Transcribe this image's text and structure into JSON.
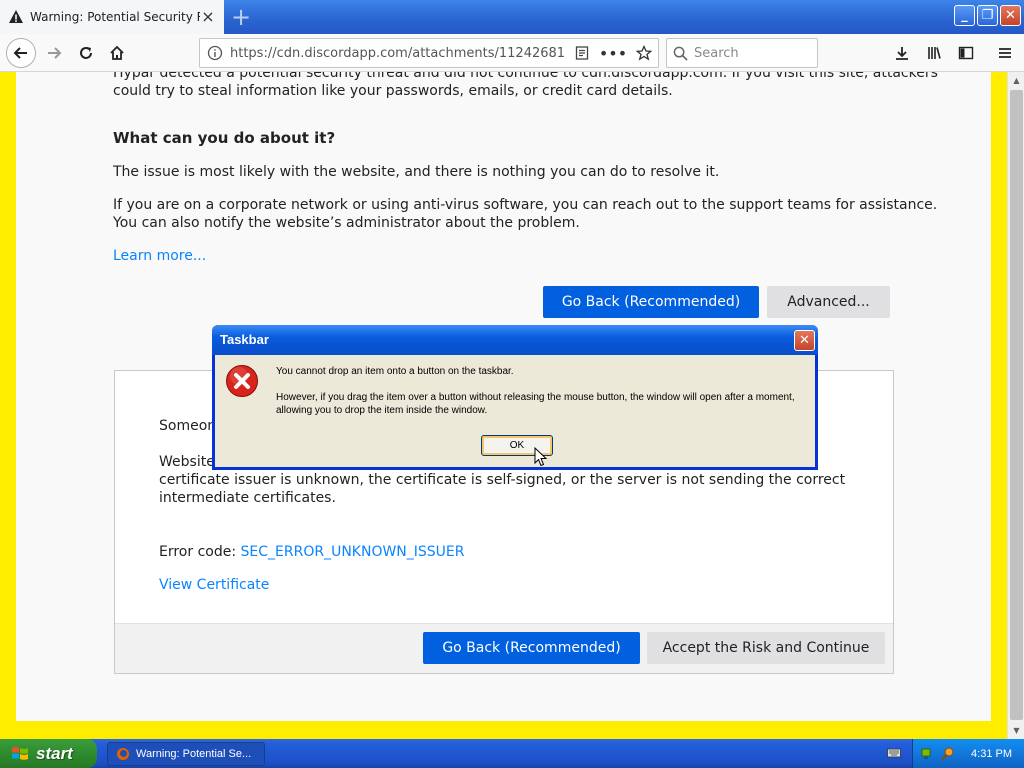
{
  "browser": {
    "tab_title": "Warning: Potential Security Risk A",
    "url": "https://cdn.discordapp.com/attachments/11242681",
    "search_placeholder": "Search"
  },
  "page": {
    "partial_top_line": "Hypar detected a potential security threat and did not continue to cdn.discordapp.com. If you visit this site, attackers",
    "line2": "could try to steal information like your passwords, emails, or credit card details.",
    "heading": "What can you do about it?",
    "para1": "The issue is most likely with the website, and there is nothing you can do to resolve it.",
    "para2a": "If you are on a corporate network or using anti-virus software, you can reach out to the support teams for assistance.",
    "para2b": "You can also notify the website’s administrator about the problem.",
    "learn_more": "Learn more...",
    "go_back": "Go Back (Recommended)",
    "advanced": "Advanced..."
  },
  "advanced_panel": {
    "someone": "Someon",
    "website": "Website",
    "line_issuer": "certificate issuer is unknown, the certificate is self-signed, or the server is not sending the correct",
    "line_intermediate": "intermediate certificates.",
    "error_code_label": "Error code:",
    "error_code": "SEC_ERROR_UNKNOWN_ISSUER",
    "view_certificate": "View Certificate",
    "go_back": "Go Back (Recommended)",
    "accept": "Accept the Risk and Continue"
  },
  "dialog": {
    "title": "Taskbar",
    "message1": "You cannot drop an item onto a button on the taskbar.",
    "message2": "However, if you drag the item over a button without releasing the mouse button, the window will open after a moment, allowing you to drop the item inside the window.",
    "ok": "OK"
  },
  "taskbar": {
    "start": "start",
    "task_item": "Warning: Potential Se...",
    "clock": "4:31 PM"
  },
  "colors": {
    "primary_button": "#0060df",
    "link": "#0a84ff",
    "page_border": "#ffed00",
    "xp_blue": "#0a5ddd"
  }
}
